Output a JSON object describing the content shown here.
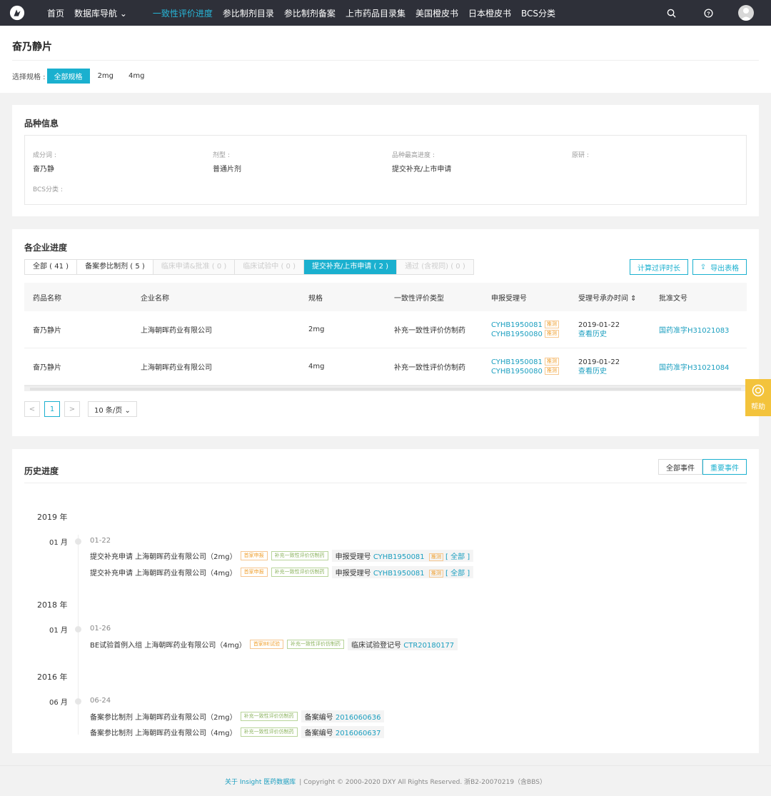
{
  "nav": {
    "items": [
      {
        "label": "首页"
      },
      {
        "label": "数据库导航 ⌄"
      },
      {
        "label": "一致性评价进度"
      },
      {
        "label": "参比制剂目录"
      },
      {
        "label": "参比制剂备案"
      },
      {
        "label": "上市药品目录集"
      },
      {
        "label": "美国橙皮书"
      },
      {
        "label": "日本橙皮书"
      },
      {
        "label": "BCS分类"
      }
    ],
    "icons": [
      "search-icon",
      "help-circle-icon",
      "avatar"
    ],
    "active_color": "#27b6d8"
  },
  "header": {
    "title": "奋乃静片",
    "spec_label": "选择规格 :",
    "specs": [
      "全部规格",
      "2mg",
      "4mg"
    ]
  },
  "info": {
    "title": "品种信息",
    "fields": [
      {
        "label": "成分词 :",
        "value": "奋乃静"
      },
      {
        "label": "剂型 :",
        "value": "普通片剂"
      },
      {
        "label": "品种最高进度 :",
        "value": "提交补充/上市申请"
      },
      {
        "label": "原研 :",
        "value": ""
      },
      {
        "label": "BCS分类 :",
        "value": ""
      }
    ]
  },
  "progress": {
    "title": "各企业进度",
    "tabs": [
      "全部 ( 41 )",
      "备案参比制剂 ( 5 )",
      "临床申请&批准 ( 0 )",
      "临床试验中 ( 0 )",
      "提交补充/上市申请 ( 2 )",
      "通过 (含视同) ( 0 )"
    ],
    "btn_calc": "计算过评时长",
    "btn_export": "导出表格",
    "columns": [
      "药品名称",
      "企业名称",
      "规格",
      "一致性评价类型",
      "申报受理号",
      "受理号承办时间 ⇕",
      "批准文号"
    ],
    "rows": [
      {
        "name": "奋乃静片",
        "company": "上海朝晖药业有限公司",
        "spec": "2mg",
        "type": "补充一致性评价仿制药",
        "acc1": "CYHB1950081",
        "acc2": "CYHB1950080",
        "acc_tag": "推测",
        "date": "2019-01-22",
        "history": "查看历史",
        "approval": "国药准字H31021083"
      },
      {
        "name": "奋乃静片",
        "company": "上海朝晖药业有限公司",
        "spec": "4mg",
        "type": "补充一致性评价仿制药",
        "acc1": "CYHB1950081",
        "acc2": "CYHB1950080",
        "acc_tag": "推测",
        "date": "2019-01-22",
        "history": "查看历史",
        "approval": "国药准字H31021084"
      }
    ],
    "pager": {
      "prev": "<",
      "page": "1",
      "next": ">",
      "size": "10 条/页 ⌄"
    }
  },
  "help": {
    "label": "帮助"
  },
  "history": {
    "title": "历史进度",
    "btn_all": "全部事件",
    "btn_important": "重要事件",
    "groups": [
      {
        "year": "2019 年",
        "month": "01 月",
        "date": "01-22",
        "events": [
          {
            "text": "提交补充申请 上海朝晖药业有限公司（2mg）",
            "tag1": "首家申报",
            "tag2": "补充一致性评价仿制药",
            "ref_label": "申报受理号",
            "ref": "CYHB1950081",
            "ref_tag": "推测",
            "all": "[ 全部 ]"
          },
          {
            "text": "提交补充申请 上海朝晖药业有限公司（4mg）",
            "tag1": "首家申报",
            "tag2": "补充一致性评价仿制药",
            "ref_label": "申报受理号",
            "ref": "CYHB1950081",
            "ref_tag": "推测",
            "all": "[ 全部 ]"
          }
        ]
      },
      {
        "year": "2018 年",
        "month": "01 月",
        "date": "01-26",
        "events": [
          {
            "text": "BE试验首例入组 上海朝晖药业有限公司（4mg）",
            "tag1": "首家BE试验",
            "tag2": "补充一致性评价仿制药",
            "ref_label": "临床试验登记号",
            "ref": "CTR20180177"
          }
        ]
      },
      {
        "year": "2016 年",
        "month": "06 月",
        "date": "06-24",
        "events": [
          {
            "text": "备案参比制剂 上海朝晖药业有限公司（2mg）",
            "tag2": "补充一致性评价仿制药",
            "ref_label": "备案编号",
            "ref": "2016060636"
          },
          {
            "text": "备案参比制剂 上海朝晖药业有限公司（4mg）",
            "tag2": "补充一致性评价仿制药",
            "ref_label": "备案编号",
            "ref": "2016060637"
          }
        ]
      }
    ]
  },
  "footer": {
    "link": "关于 Insight 医药数据库",
    "text": "|  Copyright © 2000-2020 DXY All Rights Reserved. 浙B2-20070219（含BBS）"
  }
}
